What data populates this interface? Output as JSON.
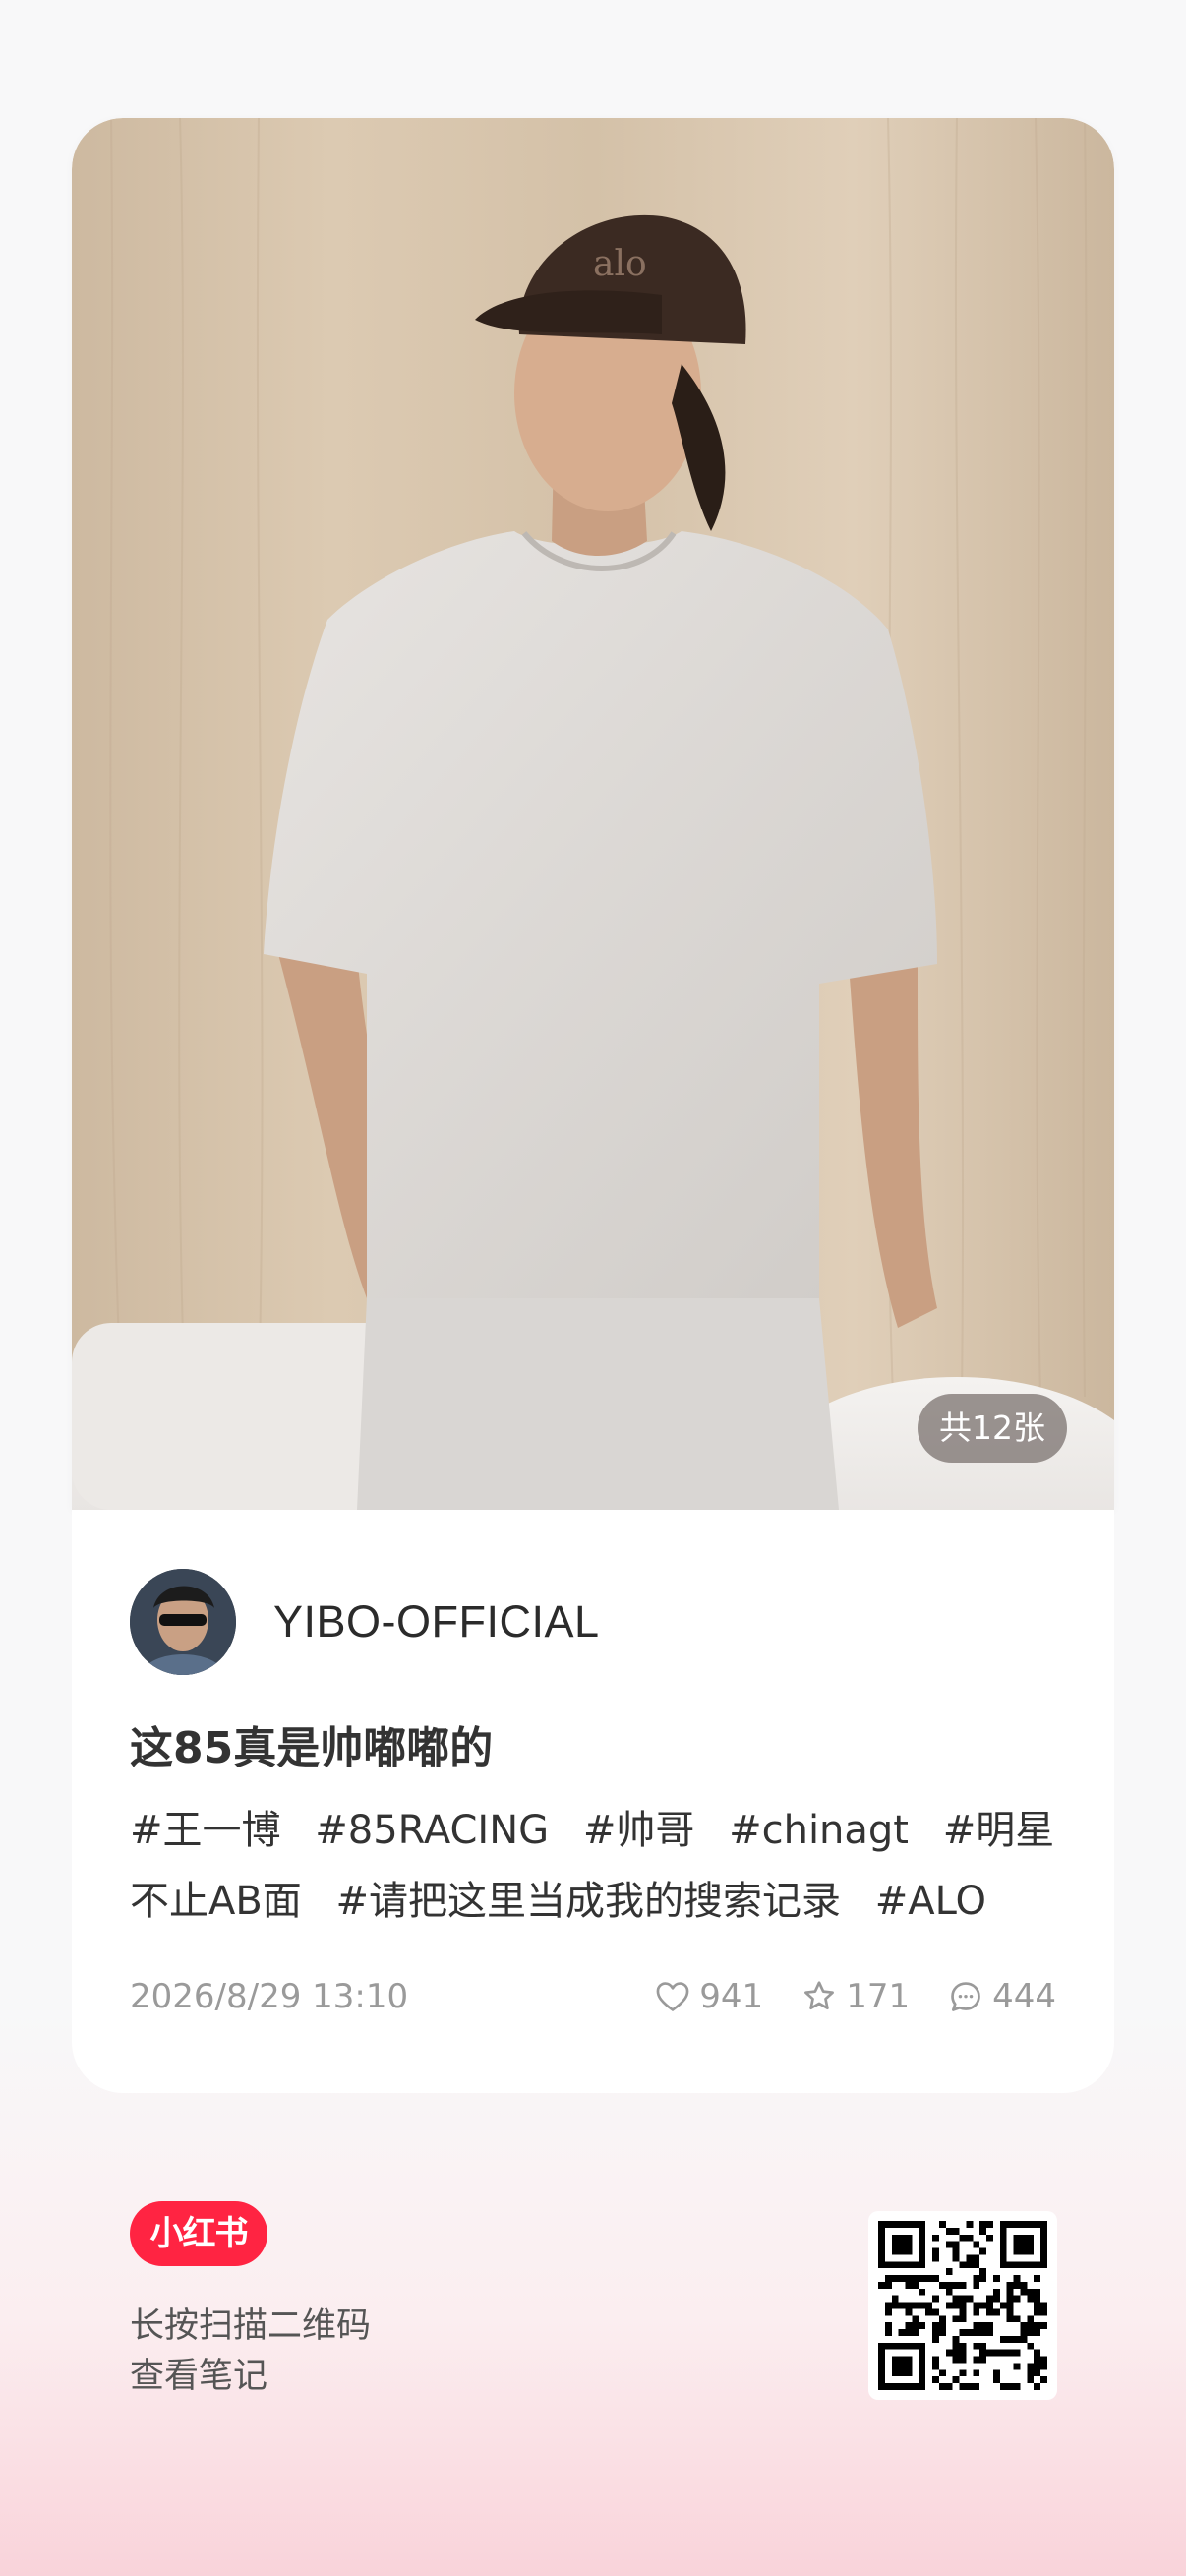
{
  "post": {
    "image_count_label": "共12张",
    "author_name": "YIBO-OFFICIAL",
    "title": "这85真是帅嘟嘟的",
    "tags": [
      "#王一博",
      "#85RACING",
      "#帅哥",
      "#chinagt",
      "#明星不止AB面",
      "#请把这里当成我的搜索记录",
      "#ALO"
    ],
    "date": "2026/8/29 13:10",
    "stats": {
      "likes": "941",
      "collects": "171",
      "comments": "444"
    }
  },
  "footer": {
    "logo_text": "小红书",
    "scan_line1": "长按扫描二维码",
    "scan_line2": "查看笔记"
  },
  "colors": {
    "brand": "#ff2442",
    "meta_text": "#9a9a9a",
    "count_badge_bg": "rgba(80,70,65,0.55)"
  },
  "icons": {
    "likes": "heart-icon",
    "collects": "star-icon",
    "comments": "comment-icon"
  }
}
